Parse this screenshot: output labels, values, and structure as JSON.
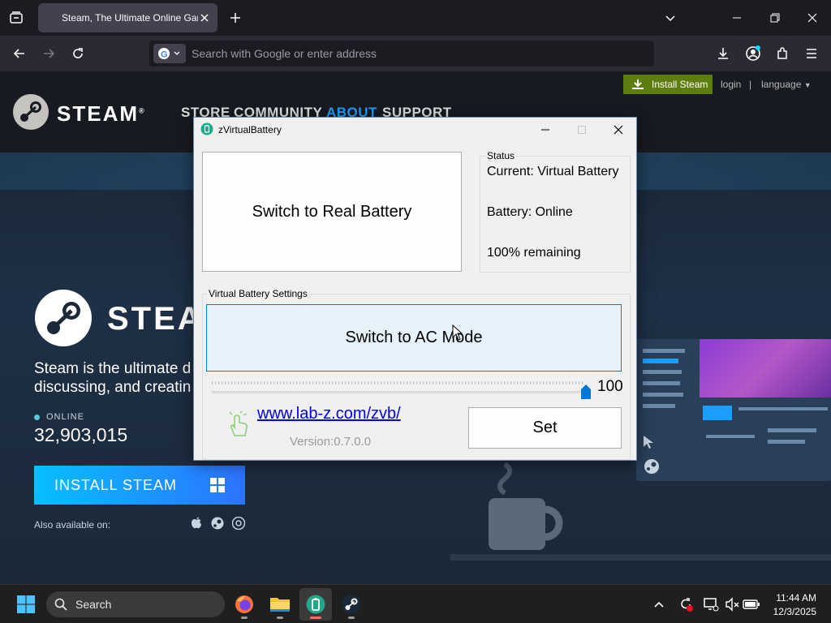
{
  "browser": {
    "tab_title": "Steam, The Ultimate Online Game Platform",
    "url_placeholder": "Search with Google or enter address"
  },
  "steam": {
    "install_steam_top": "Install Steam",
    "login": "login",
    "separator": "|",
    "language": "language",
    "logo_text": "STEAM",
    "registered_mark": "®",
    "nav": [
      "STORE",
      "COMMUNITY",
      "ABOUT",
      "SUPPORT"
    ],
    "hero_brand": "STEA",
    "tagline_line1": "Steam is the ultimate d",
    "tagline_line2": "discussing, and creatin",
    "online_label": "ONLINE",
    "online_count": "32,903,015",
    "install_steam_big": "INSTALL STEAM",
    "also_available": "Also available on:",
    "colors": {
      "install_green": "#5c7e10",
      "active_nav": "#1a9fff",
      "install_blue": "#06bfff"
    }
  },
  "zvb": {
    "title": "zVirtualBattery",
    "switch_real_label": "Switch to Real Battery",
    "status_legend": "Status",
    "status_current": "Current: Virtual Battery",
    "status_battery": "Battery: Online",
    "status_remaining": "100% remaining",
    "settings_legend": "Virtual Battery Settings",
    "ac_mode_label": "Switch to AC Mode",
    "slider_value": "100",
    "slider_level": 1.0,
    "link": "www.lab-z.com/zvb/",
    "version": "Version:0.7.0.0",
    "set_label": "Set"
  },
  "taskbar": {
    "search_label": "Search",
    "time": "11:44 AM",
    "date": "12/3/2025",
    "apps": [
      "firefox-icon",
      "file-explorer-icon",
      "zvirtualbattery-icon",
      "steam-icon"
    ]
  }
}
